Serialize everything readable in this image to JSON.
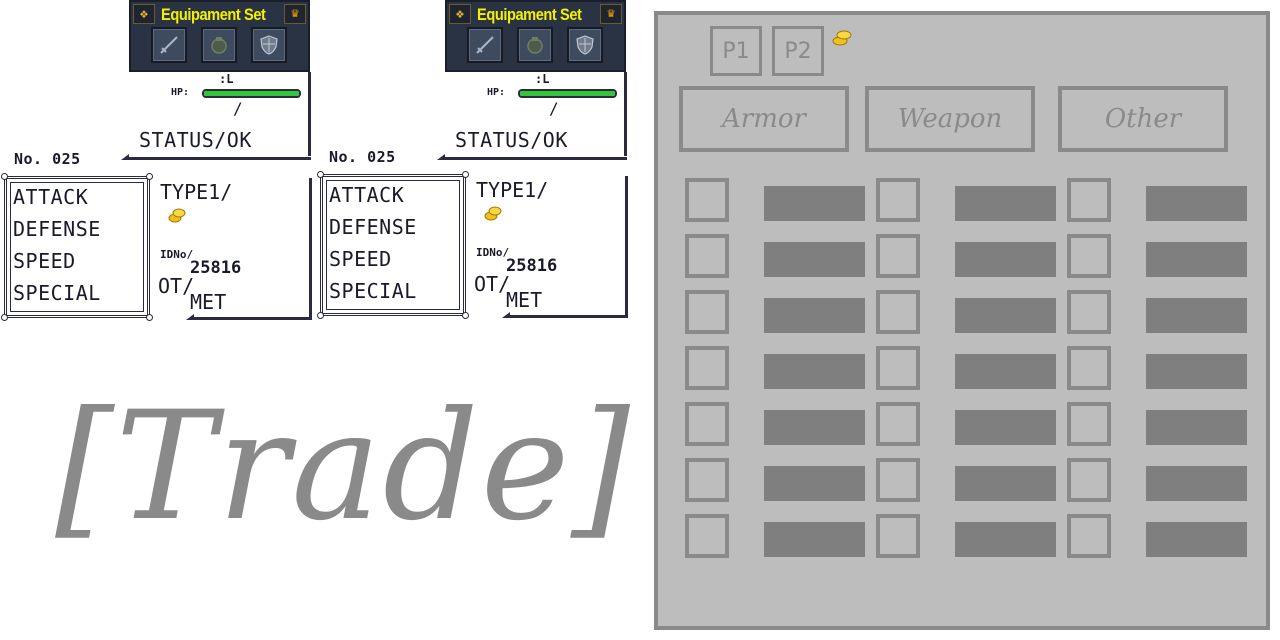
{
  "cards": [
    {
      "equip_title": "Equipament Set",
      "level": ":L",
      "hp_label": "HP:",
      "hp_fraction": 1.0,
      "hp_slash": "/",
      "status": "STATUS/OK",
      "number": "No. 025",
      "stats": [
        "ATTACK",
        "DEFENSE",
        "SPEED",
        "SPECIAL"
      ],
      "type_label": "TYPE1/",
      "idno_label": "IDNo/",
      "idno_value": "25816",
      "ot_label": "OT/",
      "met_label": "MET"
    },
    {
      "equip_title": "Equipament Set",
      "level": ":L",
      "hp_label": "HP:",
      "hp_fraction": 1.0,
      "hp_slash": "/",
      "status": "STATUS/OK",
      "number": "No. 025",
      "stats": [
        "ATTACK",
        "DEFENSE",
        "SPEED",
        "SPECIAL"
      ],
      "type_label": "TYPE1/",
      "idno_label": "IDNo/",
      "idno_value": "25816",
      "ot_label": "OT/",
      "met_label": "MET"
    }
  ],
  "equip_slot_icons": [
    "sword-icon",
    "bag-icon",
    "shield-icon"
  ],
  "trade_title": "[Trade]",
  "trade_panel": {
    "players": [
      "P1",
      "P2"
    ],
    "tabs": [
      "Armor",
      "Weapon",
      "Other"
    ],
    "rows": 7,
    "columns": 3
  },
  "colors": {
    "hp_bar": "#30c838",
    "equip_title": "#f5f000",
    "panel_bg": "#bdbdbd",
    "panel_border": "#8a8a8a",
    "slot_bar": "#7f7f7f",
    "coin": "#f0c020"
  }
}
